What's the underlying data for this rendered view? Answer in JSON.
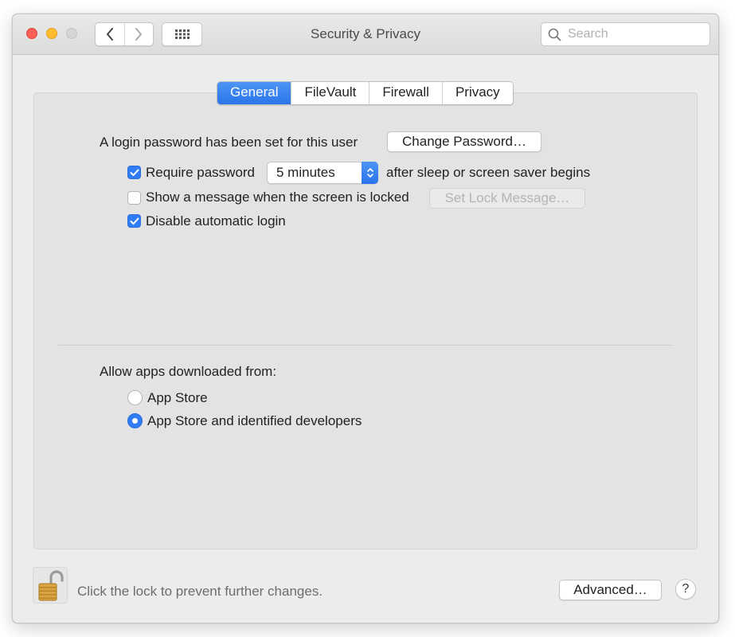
{
  "window": {
    "title": "Security & Privacy",
    "search_placeholder": "Search"
  },
  "tabs": [
    {
      "label": "General",
      "active": true
    },
    {
      "label": "FileVault",
      "active": false
    },
    {
      "label": "Firewall",
      "active": false
    },
    {
      "label": "Privacy",
      "active": false
    }
  ],
  "general": {
    "login_text": "A login password has been set for this user",
    "change_password_button": "Change Password…",
    "require_password": {
      "label": "Require password",
      "checked": true
    },
    "require_delay": "5 minutes",
    "after_sleep_text": "after sleep or screen saver begins",
    "show_message": {
      "label": "Show a message when the screen is locked",
      "checked": false
    },
    "set_lock_message_button": "Set Lock Message…",
    "disable_auto_login": {
      "label": "Disable automatic login",
      "checked": true
    }
  },
  "allow_apps": {
    "heading": "Allow apps downloaded from:",
    "options": [
      {
        "label": "App Store",
        "selected": false
      },
      {
        "label": "App Store and identified developers",
        "selected": true
      }
    ]
  },
  "footer": {
    "lock_text": "Click the lock to prevent further changes.",
    "advanced_button": "Advanced…",
    "help_label": "?"
  },
  "colors": {
    "accent": "#2f7cf6",
    "close": "#fd5f57",
    "minimize": "#febc2e",
    "lock_gold": "#d9a441"
  }
}
